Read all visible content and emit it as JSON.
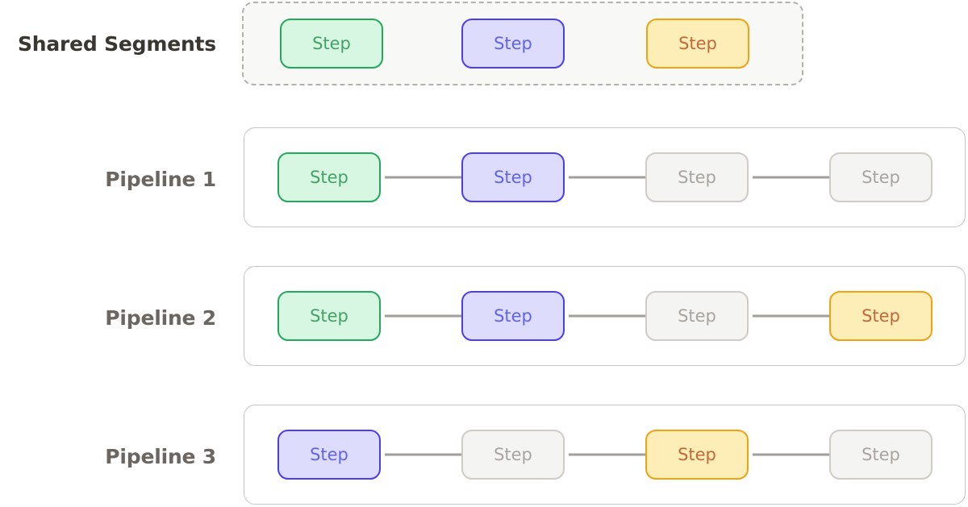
{
  "diagram": {
    "title_row_label": "Shared Segments",
    "step_label": "Step",
    "colors": {
      "green_fill": "#d8f7e2",
      "green_border": "#22a95a",
      "green_text": "#43a367",
      "blue_fill": "#dddcfc",
      "blue_border": "#4b3ef0",
      "blue_text": "#6163e8",
      "orange_fill": "#fdeeb8",
      "orange_border": "#f0a310",
      "orange_text": "#c4683a",
      "muted_fill": "#f4f4f2",
      "muted_border": "#cfcbc6",
      "muted_text": "#a9a49f",
      "connector": "#a39e99",
      "shared_box_border": "#b4b0ac",
      "shared_box_fill": "#f8f8f7",
      "pipeline_box_border": "#c8c5c1",
      "shared_label_text": "#3a3733",
      "pipeline_label_text": "#6b6661"
    },
    "shared_segments": {
      "label": "Shared Segments",
      "steps": [
        {
          "label": "Step",
          "variant": "green"
        },
        {
          "label": "Step",
          "variant": "blue"
        },
        {
          "label": "Step",
          "variant": "orange"
        }
      ]
    },
    "pipelines": [
      {
        "label": "Pipeline 1",
        "steps": [
          {
            "label": "Step",
            "variant": "green"
          },
          {
            "label": "Step",
            "variant": "blue"
          },
          {
            "label": "Step",
            "variant": "muted"
          },
          {
            "label": "Step",
            "variant": "muted"
          }
        ],
        "connectors": [
          {
            "arrowhead": true
          },
          {
            "arrowhead": true
          },
          {
            "arrowhead": true
          }
        ]
      },
      {
        "label": "Pipeline 2",
        "steps": [
          {
            "label": "Step",
            "variant": "green"
          },
          {
            "label": "Step",
            "variant": "blue"
          },
          {
            "label": "Step",
            "variant": "muted"
          },
          {
            "label": "Step",
            "variant": "orange"
          }
        ],
        "connectors": [
          {
            "arrowhead": true
          },
          {
            "arrowhead": true
          },
          {
            "arrowhead": true
          }
        ]
      },
      {
        "label": "Pipeline 3",
        "steps": [
          {
            "label": "Step",
            "variant": "blue"
          },
          {
            "label": "Step",
            "variant": "muted"
          },
          {
            "label": "Step",
            "variant": "orange"
          },
          {
            "label": "Step",
            "variant": "muted"
          }
        ],
        "connectors": [
          {
            "arrowhead": false
          },
          {
            "arrowhead": true
          },
          {
            "arrowhead": true
          }
        ]
      }
    ]
  }
}
